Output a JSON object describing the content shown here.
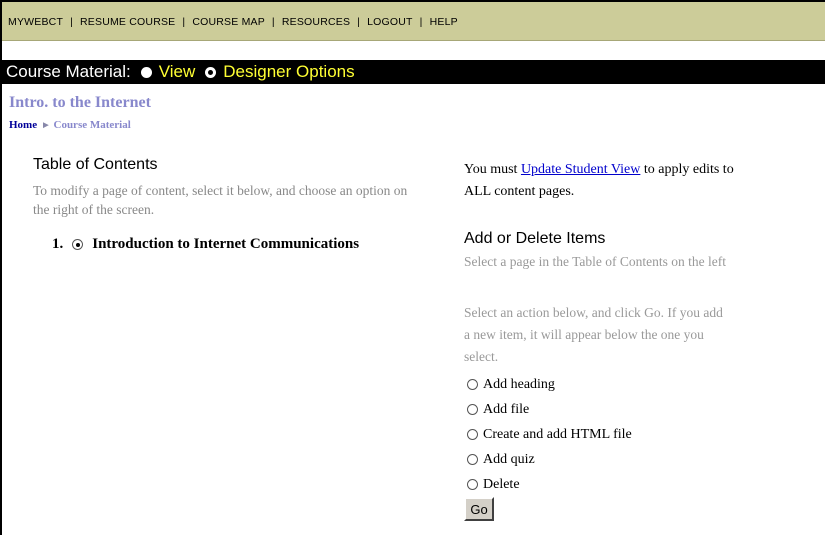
{
  "topnav": {
    "items": [
      "MYWEBCT",
      "RESUME COURSE",
      "COURSE MAP",
      "RESOURCES",
      "LOGOUT",
      "HELP"
    ],
    "separator": "|"
  },
  "mode_bar": {
    "label": "Course Material:",
    "options": [
      {
        "label": "View",
        "selected": false
      },
      {
        "label": "Designer Options",
        "selected": true
      }
    ]
  },
  "page": {
    "title": "Intro. to the Internet",
    "breadcrumb": {
      "home": "Home",
      "arrow": "▶",
      "current": "Course Material"
    }
  },
  "toc": {
    "heading": "Table of Contents",
    "instructions": "To modify a page of content, select it below, and choose an option on the right of the screen.",
    "items": [
      {
        "number": "1.",
        "title": "Introduction to Internet Communications",
        "selected": true
      }
    ]
  },
  "update": {
    "prefix": "You must",
    "link": "Update Student View",
    "suffix_line1": "to apply edits to",
    "suffix_line2": "ALL content pages."
  },
  "add_delete": {
    "heading": "Add or Delete Items",
    "select_hint": "Select a page in the Table of Contents on the left",
    "action_hint_lines": [
      "Select an action below, and click Go. If you add",
      "a new item, it will appear below the one you",
      "select."
    ],
    "options": [
      "Add heading",
      "Add file",
      "Create and add HTML file",
      "Add quiz",
      "Delete"
    ],
    "go_label": "Go"
  },
  "colors": {
    "nav_bg": "#cccc99",
    "mode_bar_bg": "#000000",
    "mode_option_text": "#ffff33",
    "title": "#8888cc",
    "link": "#0000cc",
    "hint_text": "#999999"
  }
}
